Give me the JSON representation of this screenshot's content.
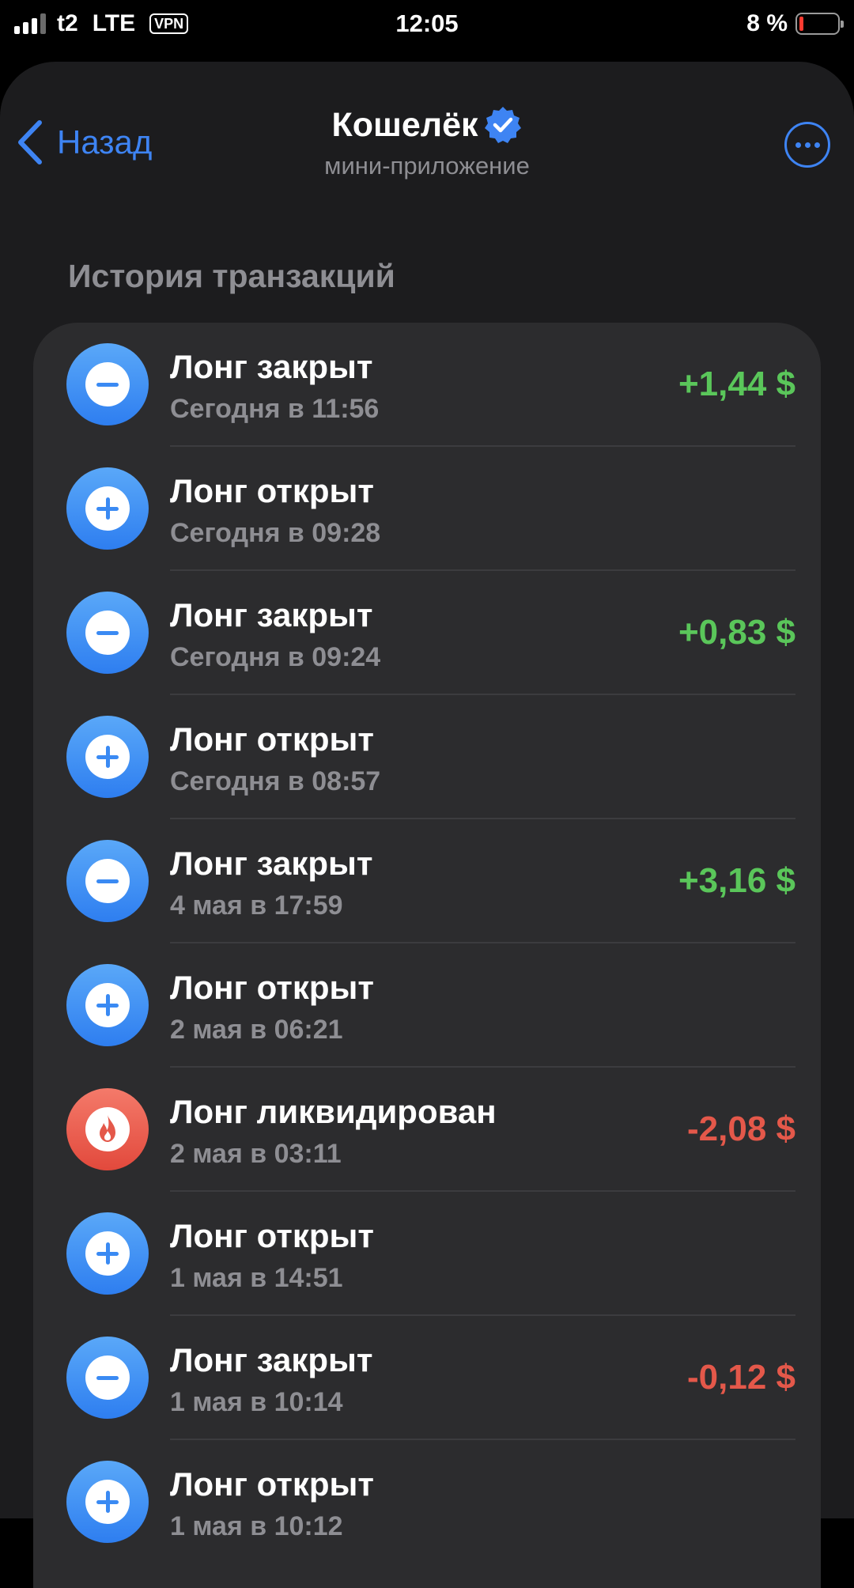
{
  "status_bar": {
    "carrier": "t2",
    "network": "LTE",
    "vpn": "VPN",
    "time": "12:05",
    "battery_percent": "8 %",
    "battery_level": 0.08
  },
  "header": {
    "back_label": "Назад",
    "title": "Кошелёк",
    "subtitle": "мини-приложение",
    "verified_icon": "verified-badge-icon",
    "more_icon": "more-icon"
  },
  "section_title": "История транзакций",
  "colors": {
    "accent": "#3e84f3",
    "positive": "#5ac65a",
    "negative": "#e4584a",
    "background": "#1c1c1e",
    "card": "#2c2c2e"
  },
  "transactions": [
    {
      "name": "Лонг закрыт",
      "date": "Сегодня в 11:56",
      "amount": "+1,44 $",
      "icon": "minus-icon",
      "kind": "pos"
    },
    {
      "name": "Лонг открыт",
      "date": "Сегодня в 09:28",
      "amount": "",
      "icon": "plus-icon",
      "kind": ""
    },
    {
      "name": "Лонг закрыт",
      "date": "Сегодня в 09:24",
      "amount": "+0,83 $",
      "icon": "minus-icon",
      "kind": "pos"
    },
    {
      "name": "Лонг открыт",
      "date": "Сегодня в 08:57",
      "amount": "",
      "icon": "plus-icon",
      "kind": ""
    },
    {
      "name": "Лонг закрыт",
      "date": "4 мая в 17:59",
      "amount": "+3,16 $",
      "icon": "minus-icon",
      "kind": "pos"
    },
    {
      "name": "Лонг открыт",
      "date": "2 мая в 06:21",
      "amount": "",
      "icon": "plus-icon",
      "kind": ""
    },
    {
      "name": "Лонг ликвидирован",
      "date": "2 мая в 03:11",
      "amount": "-2,08 $",
      "icon": "fire-icon",
      "kind": "neg"
    },
    {
      "name": "Лонг открыт",
      "date": "1 мая в 14:51",
      "amount": "",
      "icon": "plus-icon",
      "kind": ""
    },
    {
      "name": "Лонг закрыт",
      "date": "1 мая в 10:14",
      "amount": "-0,12 $",
      "icon": "minus-icon",
      "kind": "neg"
    },
    {
      "name": "Лонг открыт",
      "date": "1 мая в 10:12",
      "amount": "",
      "icon": "plus-icon",
      "kind": ""
    }
  ]
}
